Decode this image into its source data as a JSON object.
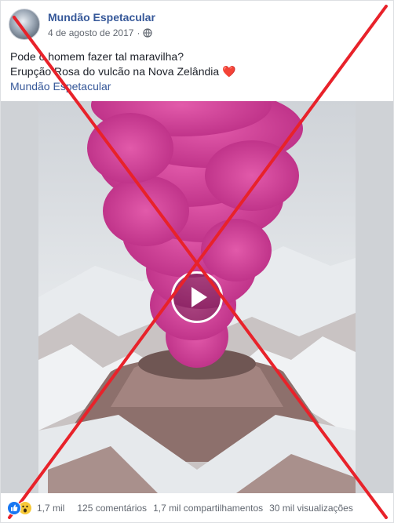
{
  "post": {
    "page_name": "Mundão Espetacular",
    "date": "4 de agosto de 2017",
    "date_separator": "·",
    "privacy_icon": "globe-icon",
    "text_line_1": "Pode o homem fazer tal maravilha?",
    "text_line_2": "Erupção Rosa do vulcão na Nova Zelândia",
    "heart_emoji": "❤️",
    "link_text": "Mundão Espetacular"
  },
  "media": {
    "type": "video",
    "play_icon": "play-icon",
    "colors": {
      "smoke": "#d6409a",
      "snow": "#eef1f4",
      "rock": "#8c6f6a",
      "sky": "#dcdfe3"
    }
  },
  "footer": {
    "reactions": [
      "like-icon",
      "wow-icon"
    ],
    "reactions_count": "1,7 mil",
    "comments": "125 comentários",
    "shares": "1,7 mil compartilhamentos",
    "views": "30 mil visualizações"
  },
  "overlay": {
    "cross_color": "#e8222a"
  }
}
